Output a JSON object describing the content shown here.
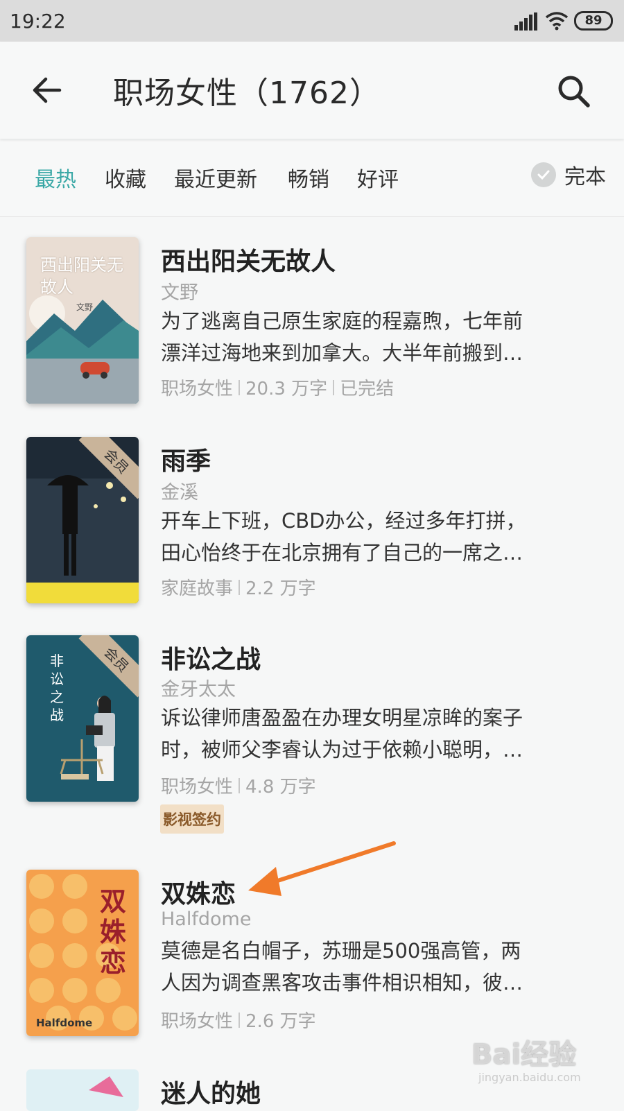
{
  "status_bar": {
    "time": "19:22",
    "battery": "89"
  },
  "header": {
    "title": "职场女性（1762）"
  },
  "tabs": [
    {
      "label": "最热"
    },
    {
      "label": "收藏"
    },
    {
      "label": "最近更新"
    },
    {
      "label": "畅销"
    },
    {
      "label": "好评"
    }
  ],
  "filter": {
    "label": "完本"
  },
  "books": [
    {
      "title": "西出阳关无故人",
      "author": "文野",
      "desc_line1": "为了逃离自己原生家庭的程嘉煦，七年前",
      "desc_line2": "漂洋过海地来到加拿大。大半年前搬到…",
      "category": "职场女性",
      "words": "20.3 万字",
      "status": "已完结",
      "cover_text": "西出阳关无故人",
      "cover_author": "文野"
    },
    {
      "title": "雨季",
      "author": "金溪",
      "desc_line1": "开车上下班，CBD办公，经过多年打拼，",
      "desc_line2": "田心怡终于在北京拥有了自己的一席之…",
      "category": "家庭故事",
      "words": "2.2 万字",
      "vip": "会员"
    },
    {
      "title": "非讼之战",
      "author": "金牙太太",
      "desc_line1": "诉讼律师唐盈盈在办理女明星凉眸的案子",
      "desc_line2": "时，被师父李睿认为过于依赖小聪明，…",
      "category": "职场女性",
      "words": "4.8 万字",
      "badge": "影视签约",
      "vip": "会员",
      "cover_text": "非讼之战"
    },
    {
      "title": "双姝恋",
      "author": "Halfdome",
      "desc_line1": "莫德是名白帽子，苏珊是500强高管，两",
      "desc_line2": "人因为调查黑客攻击事件相识相知，彼…",
      "category": "职场女性",
      "words": "2.6 万字",
      "cover_text": "双姝恋",
      "cover_author": "Halfdome"
    },
    {
      "title": "迷人的她"
    }
  ],
  "watermark": {
    "main": "Bai经验",
    "sub": "jingyan.baidu.com"
  },
  "colors": {
    "accent": "#3aa8a6",
    "arrow": "#f07a2a"
  }
}
